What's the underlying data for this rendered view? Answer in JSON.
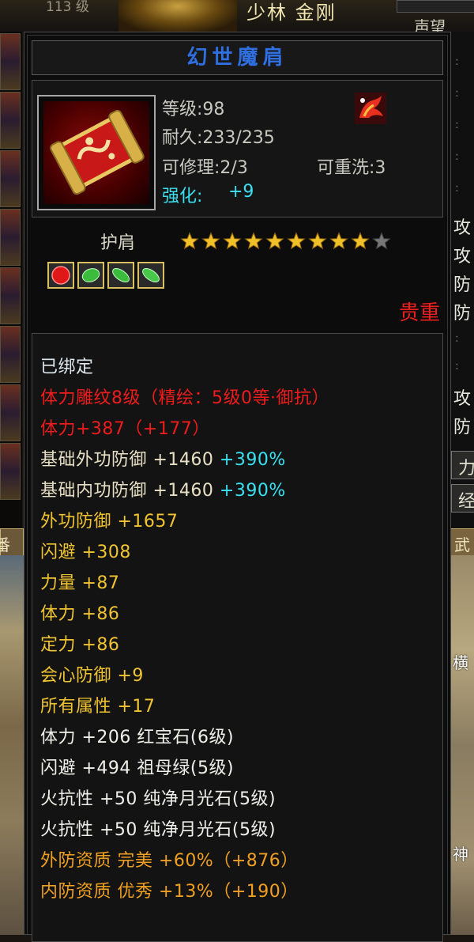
{
  "background": {
    "level_text": "113 级",
    "character_name": "少林 金刚",
    "side_label": "声望",
    "left_tab": "番",
    "right_chars": [
      "攻",
      "攻",
      "防",
      "防",
      "攻",
      "防"
    ],
    "right_boxes": [
      "力",
      "经"
    ],
    "right_tab": "武",
    "scene_text_1": "横",
    "scene_text_2": "神"
  },
  "tooltip": {
    "title": "幻世魔肩",
    "level": "等级:98",
    "durability": "耐久:233/235",
    "repairable": "可修理:2/3",
    "rewashable": "可重洗:3",
    "enhance_label": "强化:",
    "enhance_value": "+9",
    "slot": "护肩",
    "stars_total": 10,
    "stars_filled": 9,
    "rarity": "贵重",
    "gems": [
      {
        "name": "red-gem",
        "color": "#e01818"
      },
      {
        "name": "emerald-gem",
        "color": "#3cbc3c"
      },
      {
        "name": "moonstone-gem",
        "color": "#3cbc3c"
      },
      {
        "name": "moonstone-gem",
        "color": "#48c848"
      }
    ],
    "lines": {
      "bound": "已绑定",
      "engrave": "体力雕纹8级（精绘：5级0等·御抗）",
      "stamina_engrave": "体力+387（+177）",
      "base_ext_def": "基础外功防御 +1460",
      "base_ext_def_pct": "+390%",
      "base_int_def": "基础内功防御 +1460",
      "base_int_def_pct": "+390%",
      "ext_def": "外功防御 +1657",
      "dodge": "闪避 +308",
      "strength": "力量 +87",
      "stamina": "体力 +86",
      "focus": "定力 +86",
      "crit_def": "会心防御 +9",
      "all_attr": "所有属性 +17",
      "gem1": "体力 +206 红宝石(6级)",
      "gem2": "闪避 +494 祖母绿(5级)",
      "gem3": "火抗性 +50 纯净月光石(5级)",
      "gem4": "火抗性 +50 纯净月光石(5级)",
      "ext_quality": "外防资质  完美 +60%（+876）",
      "int_quality": "内防资质  优秀 +13%（+190）"
    },
    "colors": {
      "title": "#2f6fe0",
      "bound": "#dfe8ee",
      "red": "#ee1c1c",
      "beige": "#e8e0c4",
      "yellow": "#f0c430",
      "cyan": "#38e0f0",
      "orange": "#f0a020",
      "star_gold": "#f0c028",
      "star_gray": "#777777"
    }
  }
}
